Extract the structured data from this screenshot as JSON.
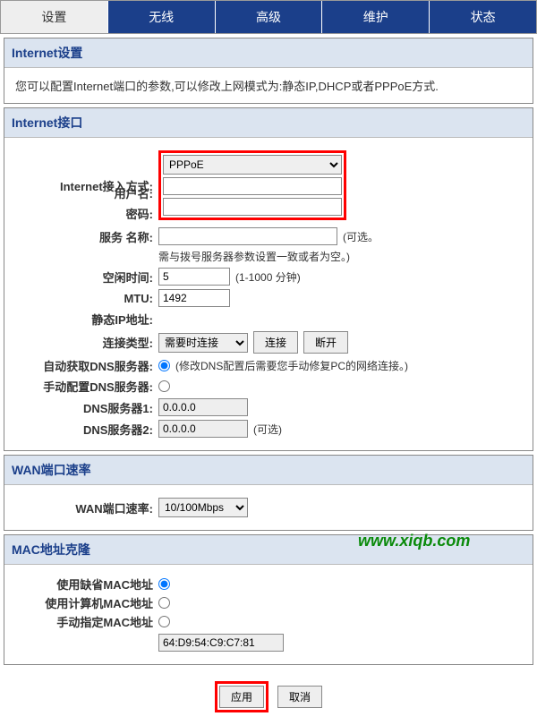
{
  "tabs": [
    "设置",
    "无线",
    "高级",
    "维护",
    "状态"
  ],
  "activeTab": 0,
  "sec1": {
    "title": "Internet设置",
    "desc": "您可以配置Internet端口的参数,可以修改上网模式为:静态IP,DHCP或者PPPoE方式."
  },
  "sec2": {
    "title": "Internet接口",
    "labels": {
      "accessMode": "Internet接入方式:",
      "username": "用户名:",
      "password": "密码:",
      "serviceName": "服务 名称:",
      "idleTime": "空闲时间:",
      "mtu": "MTU:",
      "staticIp": "静态IP地址:",
      "connType": "连接类型:",
      "autoDns": "自动获取DNS服务器:",
      "manualDns": "手动配置DNS服务器:",
      "dns1": "DNS服务器1:",
      "dns2": "DNS服务器2:"
    },
    "values": {
      "accessMode": "PPPoE",
      "username": "",
      "password": "",
      "serviceName": "",
      "idleTime": "5",
      "mtu": "1492",
      "staticIp": "",
      "connType": "需要时连接",
      "dns1": "0.0.0.0",
      "dns2": "0.0.0.0"
    },
    "notes": {
      "serviceNameOpt": "(可选。",
      "serviceNameHint": "需与拨号服务器参数设置一致或者为空。)",
      "idleTimeHint": "(1-1000 分钟)",
      "dnsHint": "(修改DNS配置后需要您手动修复PC的网络连接。)",
      "dns2Hint": "(可选)"
    },
    "buttons": {
      "connect": "连接",
      "disconnect": "断开"
    }
  },
  "sec3": {
    "title": "WAN端口速率",
    "label": "WAN端口速率:",
    "value": "10/100Mbps"
  },
  "sec4": {
    "title": "MAC地址克隆",
    "opts": {
      "default": "使用缺省MAC地址",
      "pc": "使用计算机MAC地址",
      "manual": "手动指定MAC地址"
    },
    "mac": "64:D9:54:C9:C7:81"
  },
  "bottom": {
    "apply": "应用",
    "cancel": "取消"
  },
  "watermark": "www.xiqb.com"
}
